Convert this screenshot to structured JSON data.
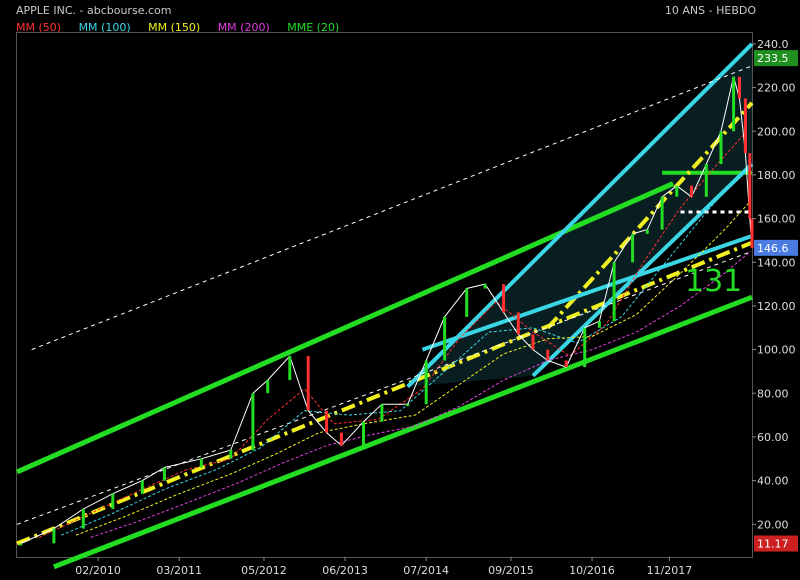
{
  "header": {
    "title": "APPLE INC. - abcbourse.com",
    "period": "10 ANS - HEBDO"
  },
  "legend": [
    {
      "label": "MM (50)",
      "color": "#ff3030"
    },
    {
      "label": "MM (100)",
      "color": "#3ad6e6"
    },
    {
      "label": "MM (150)",
      "color": "#f0f020"
    },
    {
      "label": "MM (200)",
      "color": "#e040e0"
    },
    {
      "label": "MME (20)",
      "color": "#22dd22"
    }
  ],
  "annotation": "131",
  "badges": {
    "high": "233.5",
    "last": "146.6",
    "low": "11.17"
  },
  "chart_data": {
    "type": "line",
    "title": "APPLE INC. - abcbourse.com",
    "ylim": [
      5,
      245
    ],
    "y_ticks": [
      20,
      40,
      60,
      80,
      100,
      120,
      140,
      160,
      180,
      200,
      220,
      240
    ],
    "y_tick_labels": [
      "20.00",
      "40.00",
      "60.00",
      "80.00",
      "100.00",
      "120.00",
      "140.00",
      "160.00",
      "180.00",
      "200.00",
      "220.00",
      "240.0"
    ],
    "x_tick_labels": [
      "02/2010",
      "03/2011",
      "05/2012",
      "06/2013",
      "07/2014",
      "09/2015",
      "10/2016",
      "11/2017"
    ],
    "x_tick_positions": [
      2010.1,
      2011.2,
      2012.35,
      2013.45,
      2014.55,
      2015.7,
      2016.8,
      2017.85
    ],
    "xlim": [
      2009.0,
      2018.97
    ],
    "price_points": [
      [
        2009.05,
        11.2
      ],
      [
        2009.5,
        18
      ],
      [
        2009.9,
        27
      ],
      [
        2010.3,
        34
      ],
      [
        2010.7,
        40
      ],
      [
        2011.0,
        46
      ],
      [
        2011.5,
        50
      ],
      [
        2011.9,
        54
      ],
      [
        2012.2,
        80
      ],
      [
        2012.4,
        86
      ],
      [
        2012.7,
        97
      ],
      [
        2012.95,
        72
      ],
      [
        2013.2,
        62
      ],
      [
        2013.4,
        56
      ],
      [
        2013.7,
        67
      ],
      [
        2013.95,
        75
      ],
      [
        2014.3,
        75
      ],
      [
        2014.55,
        95
      ],
      [
        2014.8,
        115
      ],
      [
        2015.1,
        128
      ],
      [
        2015.35,
        130
      ],
      [
        2015.6,
        117
      ],
      [
        2015.8,
        107
      ],
      [
        2016.0,
        100
      ],
      [
        2016.2,
        95
      ],
      [
        2016.45,
        92
      ],
      [
        2016.7,
        110
      ],
      [
        2016.9,
        113
      ],
      [
        2017.1,
        140
      ],
      [
        2017.35,
        153
      ],
      [
        2017.55,
        155
      ],
      [
        2017.75,
        170
      ],
      [
        2017.95,
        175
      ],
      [
        2018.15,
        170
      ],
      [
        2018.35,
        185
      ],
      [
        2018.55,
        200
      ],
      [
        2018.72,
        225
      ],
      [
        2018.8,
        215
      ],
      [
        2018.88,
        190
      ],
      [
        2018.94,
        160
      ],
      [
        2018.97,
        146.6
      ]
    ],
    "ma50": [
      [
        2009.3,
        14
      ],
      [
        2010.0,
        25
      ],
      [
        2010.7,
        36
      ],
      [
        2011.3,
        45
      ],
      [
        2011.9,
        50
      ],
      [
        2012.4,
        68
      ],
      [
        2012.9,
        82
      ],
      [
        2013.3,
        66
      ],
      [
        2013.9,
        68
      ],
      [
        2014.5,
        82
      ],
      [
        2015.0,
        105
      ],
      [
        2015.5,
        122
      ],
      [
        2016.0,
        108
      ],
      [
        2016.5,
        97
      ],
      [
        2017.0,
        112
      ],
      [
        2017.5,
        140
      ],
      [
        2018.0,
        165
      ],
      [
        2018.5,
        185
      ],
      [
        2018.9,
        200
      ]
    ],
    "ma100": [
      [
        2009.6,
        15
      ],
      [
        2010.3,
        25
      ],
      [
        2011.0,
        36
      ],
      [
        2011.7,
        45
      ],
      [
        2012.3,
        55
      ],
      [
        2012.9,
        72
      ],
      [
        2013.5,
        70
      ],
      [
        2014.2,
        72
      ],
      [
        2014.8,
        90
      ],
      [
        2015.4,
        108
      ],
      [
        2016.0,
        110
      ],
      [
        2016.6,
        103
      ],
      [
        2017.2,
        115
      ],
      [
        2017.8,
        140
      ],
      [
        2018.4,
        165
      ],
      [
        2018.95,
        185
      ]
    ],
    "ma150": [
      [
        2009.8,
        15
      ],
      [
        2010.5,
        24
      ],
      [
        2011.2,
        34
      ],
      [
        2011.9,
        43
      ],
      [
        2012.5,
        52
      ],
      [
        2013.1,
        62
      ],
      [
        2013.7,
        66
      ],
      [
        2014.4,
        70
      ],
      [
        2015.0,
        84
      ],
      [
        2015.6,
        98
      ],
      [
        2016.2,
        105
      ],
      [
        2016.8,
        106
      ],
      [
        2017.4,
        116
      ],
      [
        2018.0,
        135
      ],
      [
        2018.6,
        155
      ],
      [
        2018.95,
        168
      ]
    ],
    "ma200": [
      [
        2010.0,
        14
      ],
      [
        2010.7,
        22
      ],
      [
        2011.4,
        31
      ],
      [
        2012.0,
        39
      ],
      [
        2012.6,
        48
      ],
      [
        2013.2,
        56
      ],
      [
        2013.8,
        61
      ],
      [
        2014.4,
        65
      ],
      [
        2015.0,
        74
      ],
      [
        2015.6,
        86
      ],
      [
        2016.2,
        95
      ],
      [
        2016.8,
        100
      ],
      [
        2017.4,
        108
      ],
      [
        2018.0,
        120
      ],
      [
        2018.6,
        135
      ],
      [
        2018.95,
        145
      ]
    ],
    "trendlines": [
      {
        "color": "#22dd22",
        "width": 5,
        "dash": "",
        "points": [
          [
            2009.0,
            44
          ],
          [
            2017.9,
            176
          ]
        ]
      },
      {
        "color": "#22dd22",
        "width": 5,
        "dash": "",
        "points": [
          [
            2009.5,
            0.5
          ],
          [
            2018.97,
            124
          ]
        ]
      },
      {
        "color": "#22dd22",
        "width": 4,
        "dash": "",
        "points": [
          [
            2017.75,
            181
          ],
          [
            2018.97,
            181
          ]
        ]
      },
      {
        "color": "#f0f020",
        "width": 4,
        "dash": "14 5 3 5",
        "points": [
          [
            2009.0,
            11.17
          ],
          [
            2018.97,
            149
          ]
        ]
      },
      {
        "color": "#f0f020",
        "width": 4,
        "dash": "14 5 3 5",
        "points": [
          [
            2016.2,
            110
          ],
          [
            2018.97,
            213
          ]
        ]
      },
      {
        "color": "#3ad6e6",
        "width": 4,
        "dash": "",
        "points": [
          [
            2014.3,
            83
          ],
          [
            2018.97,
            240
          ]
        ]
      },
      {
        "color": "#3ad6e6",
        "width": 4,
        "dash": "",
        "points": [
          [
            2016.0,
            88
          ],
          [
            2018.97,
            185
          ]
        ]
      },
      {
        "color": "#3ad6e6",
        "width": 4,
        "dash": "",
        "points": [
          [
            2014.5,
            100
          ],
          [
            2018.97,
            152
          ]
        ]
      },
      {
        "color": "#ffffff",
        "width": 1,
        "dash": "4 4",
        "points": [
          [
            2009.2,
            100
          ],
          [
            2018.97,
            230
          ]
        ]
      },
      {
        "color": "#ffffff",
        "width": 1,
        "dash": "4 4",
        "points": [
          [
            2009.0,
            20
          ],
          [
            2018.97,
            145
          ]
        ]
      },
      {
        "color": "#ffffff",
        "width": 3,
        "dash": "4 4",
        "points": [
          [
            2018.0,
            163
          ],
          [
            2018.97,
            163
          ]
        ]
      }
    ]
  }
}
